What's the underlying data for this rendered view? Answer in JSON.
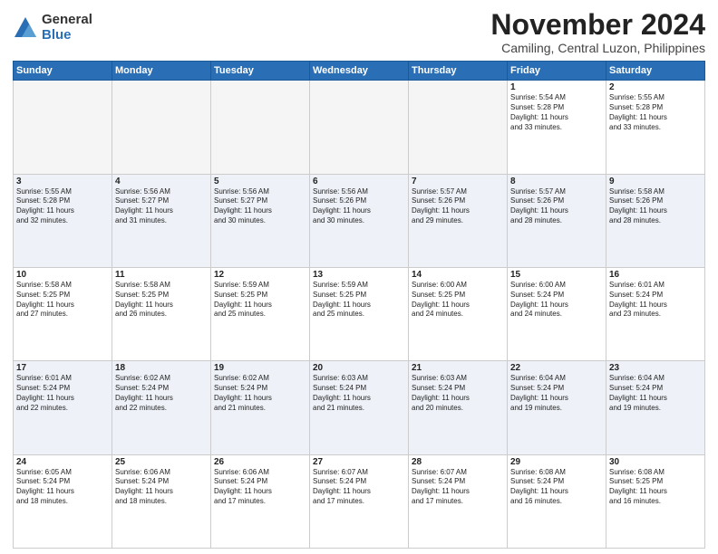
{
  "header": {
    "logo": {
      "general": "General",
      "blue": "Blue"
    },
    "title": "November 2024",
    "subtitle": "Camiling, Central Luzon, Philippines"
  },
  "weekdays": [
    "Sunday",
    "Monday",
    "Tuesday",
    "Wednesday",
    "Thursday",
    "Friday",
    "Saturday"
  ],
  "weeks": [
    [
      {
        "day": "",
        "info": ""
      },
      {
        "day": "",
        "info": ""
      },
      {
        "day": "",
        "info": ""
      },
      {
        "day": "",
        "info": ""
      },
      {
        "day": "",
        "info": ""
      },
      {
        "day": "1",
        "info": "Sunrise: 5:54 AM\nSunset: 5:28 PM\nDaylight: 11 hours\nand 33 minutes."
      },
      {
        "day": "2",
        "info": "Sunrise: 5:55 AM\nSunset: 5:28 PM\nDaylight: 11 hours\nand 33 minutes."
      }
    ],
    [
      {
        "day": "3",
        "info": "Sunrise: 5:55 AM\nSunset: 5:28 PM\nDaylight: 11 hours\nand 32 minutes."
      },
      {
        "day": "4",
        "info": "Sunrise: 5:56 AM\nSunset: 5:27 PM\nDaylight: 11 hours\nand 31 minutes."
      },
      {
        "day": "5",
        "info": "Sunrise: 5:56 AM\nSunset: 5:27 PM\nDaylight: 11 hours\nand 30 minutes."
      },
      {
        "day": "6",
        "info": "Sunrise: 5:56 AM\nSunset: 5:26 PM\nDaylight: 11 hours\nand 30 minutes."
      },
      {
        "day": "7",
        "info": "Sunrise: 5:57 AM\nSunset: 5:26 PM\nDaylight: 11 hours\nand 29 minutes."
      },
      {
        "day": "8",
        "info": "Sunrise: 5:57 AM\nSunset: 5:26 PM\nDaylight: 11 hours\nand 28 minutes."
      },
      {
        "day": "9",
        "info": "Sunrise: 5:58 AM\nSunset: 5:26 PM\nDaylight: 11 hours\nand 28 minutes."
      }
    ],
    [
      {
        "day": "10",
        "info": "Sunrise: 5:58 AM\nSunset: 5:25 PM\nDaylight: 11 hours\nand 27 minutes."
      },
      {
        "day": "11",
        "info": "Sunrise: 5:58 AM\nSunset: 5:25 PM\nDaylight: 11 hours\nand 26 minutes."
      },
      {
        "day": "12",
        "info": "Sunrise: 5:59 AM\nSunset: 5:25 PM\nDaylight: 11 hours\nand 25 minutes."
      },
      {
        "day": "13",
        "info": "Sunrise: 5:59 AM\nSunset: 5:25 PM\nDaylight: 11 hours\nand 25 minutes."
      },
      {
        "day": "14",
        "info": "Sunrise: 6:00 AM\nSunset: 5:25 PM\nDaylight: 11 hours\nand 24 minutes."
      },
      {
        "day": "15",
        "info": "Sunrise: 6:00 AM\nSunset: 5:24 PM\nDaylight: 11 hours\nand 24 minutes."
      },
      {
        "day": "16",
        "info": "Sunrise: 6:01 AM\nSunset: 5:24 PM\nDaylight: 11 hours\nand 23 minutes."
      }
    ],
    [
      {
        "day": "17",
        "info": "Sunrise: 6:01 AM\nSunset: 5:24 PM\nDaylight: 11 hours\nand 22 minutes."
      },
      {
        "day": "18",
        "info": "Sunrise: 6:02 AM\nSunset: 5:24 PM\nDaylight: 11 hours\nand 22 minutes."
      },
      {
        "day": "19",
        "info": "Sunrise: 6:02 AM\nSunset: 5:24 PM\nDaylight: 11 hours\nand 21 minutes."
      },
      {
        "day": "20",
        "info": "Sunrise: 6:03 AM\nSunset: 5:24 PM\nDaylight: 11 hours\nand 21 minutes."
      },
      {
        "day": "21",
        "info": "Sunrise: 6:03 AM\nSunset: 5:24 PM\nDaylight: 11 hours\nand 20 minutes."
      },
      {
        "day": "22",
        "info": "Sunrise: 6:04 AM\nSunset: 5:24 PM\nDaylight: 11 hours\nand 19 minutes."
      },
      {
        "day": "23",
        "info": "Sunrise: 6:04 AM\nSunset: 5:24 PM\nDaylight: 11 hours\nand 19 minutes."
      }
    ],
    [
      {
        "day": "24",
        "info": "Sunrise: 6:05 AM\nSunset: 5:24 PM\nDaylight: 11 hours\nand 18 minutes."
      },
      {
        "day": "25",
        "info": "Sunrise: 6:06 AM\nSunset: 5:24 PM\nDaylight: 11 hours\nand 18 minutes."
      },
      {
        "day": "26",
        "info": "Sunrise: 6:06 AM\nSunset: 5:24 PM\nDaylight: 11 hours\nand 17 minutes."
      },
      {
        "day": "27",
        "info": "Sunrise: 6:07 AM\nSunset: 5:24 PM\nDaylight: 11 hours\nand 17 minutes."
      },
      {
        "day": "28",
        "info": "Sunrise: 6:07 AM\nSunset: 5:24 PM\nDaylight: 11 hours\nand 17 minutes."
      },
      {
        "day": "29",
        "info": "Sunrise: 6:08 AM\nSunset: 5:24 PM\nDaylight: 11 hours\nand 16 minutes."
      },
      {
        "day": "30",
        "info": "Sunrise: 6:08 AM\nSunset: 5:25 PM\nDaylight: 11 hours\nand 16 minutes."
      }
    ]
  ]
}
